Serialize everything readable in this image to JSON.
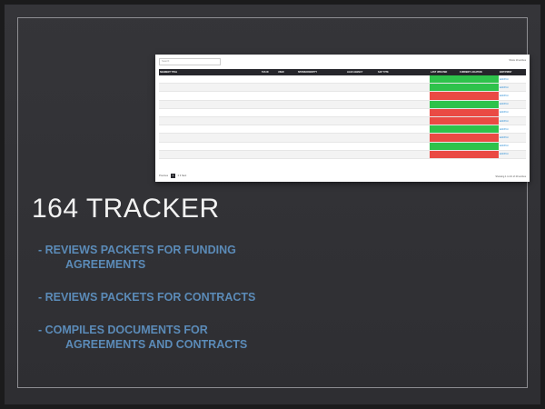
{
  "slide": {
    "title": "164 TRACKER",
    "bullets": [
      {
        "line1": "- REVIEWS PACKETS FOR FUNDING",
        "line2": "AGREEMENTS"
      },
      {
        "line1": "- REVIEWS PACKETS FOR CONTRACTS",
        "line2": ""
      },
      {
        "line1": "- COMPILES DOCUMENTS FOR",
        "line2": "AGREEMENTS AND CONTRACTS"
      }
    ],
    "bullet_color": "#5b8bb8",
    "background_color": "#313136"
  },
  "tracker_screenshot": {
    "search_label": "Search:",
    "show_label": "Show 10 entries",
    "columns": [
      "SEGMENT TITLE",
      "TAS ID",
      "USER",
      "SPONSOR/ENTITY",
      "LEAD AGENCY",
      "SAP TYPE",
      "LAST UPDATED",
      "CURRENT LOCATION",
      "EDIT/PRINT"
    ],
    "rows": [
      {
        "status": "green"
      },
      {
        "status": "green"
      },
      {
        "status": "red"
      },
      {
        "status": "green"
      },
      {
        "status": "red"
      },
      {
        "status": "red"
      },
      {
        "status": "green"
      },
      {
        "status": "red"
      },
      {
        "status": "green"
      },
      {
        "status": "red"
      }
    ],
    "pager_prev": "Previous",
    "pager_pages": [
      "1",
      "2",
      "3"
    ],
    "pager_next": "Next",
    "showing_text": "Showing 1 to 10 of 20 entries",
    "edit_link": "Edit/Print",
    "status_colors": {
      "green": "#2ec24b",
      "red": "#ea4a44"
    }
  }
}
